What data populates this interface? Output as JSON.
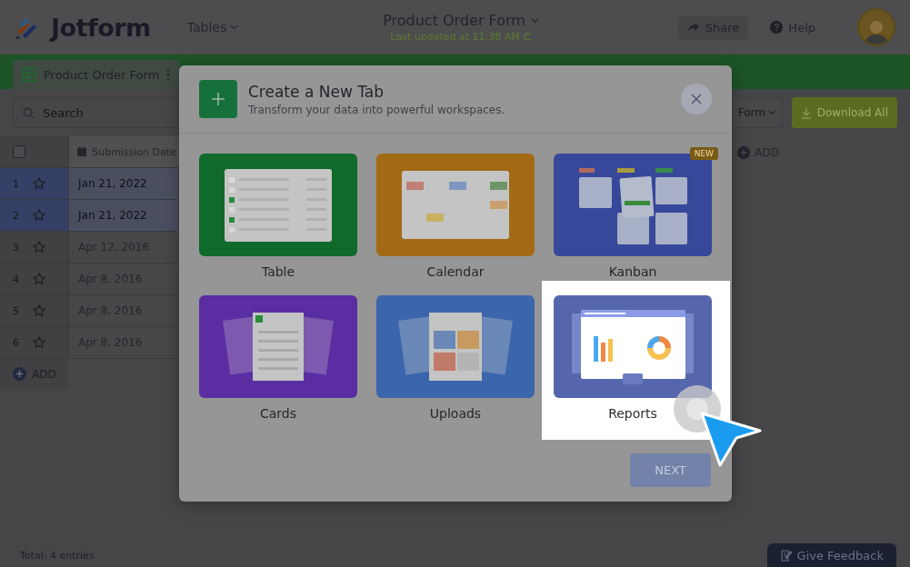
{
  "header": {
    "logo": "Jotform",
    "menu": "Tables",
    "title": "Product Order Form",
    "subtitle": "Last updated at 11:38 AM",
    "share": "Share",
    "help": "Help"
  },
  "tabs": [
    {
      "label": "Product Order Form",
      "selected": true
    }
  ],
  "toolbar": {
    "search": {
      "placeholder": "Search"
    },
    "form_filter": "Form",
    "download": "Download All"
  },
  "table": {
    "select_all_checked": false,
    "columns": [
      "Submission Date"
    ],
    "add_column": "ADD",
    "rows": [
      {
        "number": "1",
        "date": "Jan 21, 2022",
        "selected": true
      },
      {
        "number": "2",
        "date": "Jan 21, 2022",
        "selected": true
      },
      {
        "number": "3",
        "date": "Apr 12, 2016",
        "selected": false
      },
      {
        "number": "4",
        "date": "Apr 8, 2016",
        "selected": false
      },
      {
        "number": "5",
        "date": "Apr 8, 2016",
        "selected": false
      },
      {
        "number": "6",
        "date": "Apr 8, 2016",
        "selected": false
      }
    ],
    "add_row": "ADD"
  },
  "footer": {
    "total": "Total: 4 entries",
    "feedback": "Give Feedback"
  },
  "dialog": {
    "title": "Create a New Tab",
    "subtitle": "Transform your data into powerful workspaces.",
    "options": [
      {
        "kind": "table",
        "label": "Table",
        "highlighted": false
      },
      {
        "kind": "calendar",
        "label": "Calendar",
        "highlighted": false
      },
      {
        "kind": "kanban",
        "label": "Kanban",
        "badge": "NEW",
        "highlighted": false
      },
      {
        "kind": "cards",
        "label": "Cards",
        "highlighted": false
      },
      {
        "kind": "uploads",
        "label": "Uploads",
        "highlighted": false
      },
      {
        "kind": "reports",
        "label": "Reports",
        "highlighted": true
      }
    ],
    "next": "NEXT",
    "next_disabled": true
  }
}
